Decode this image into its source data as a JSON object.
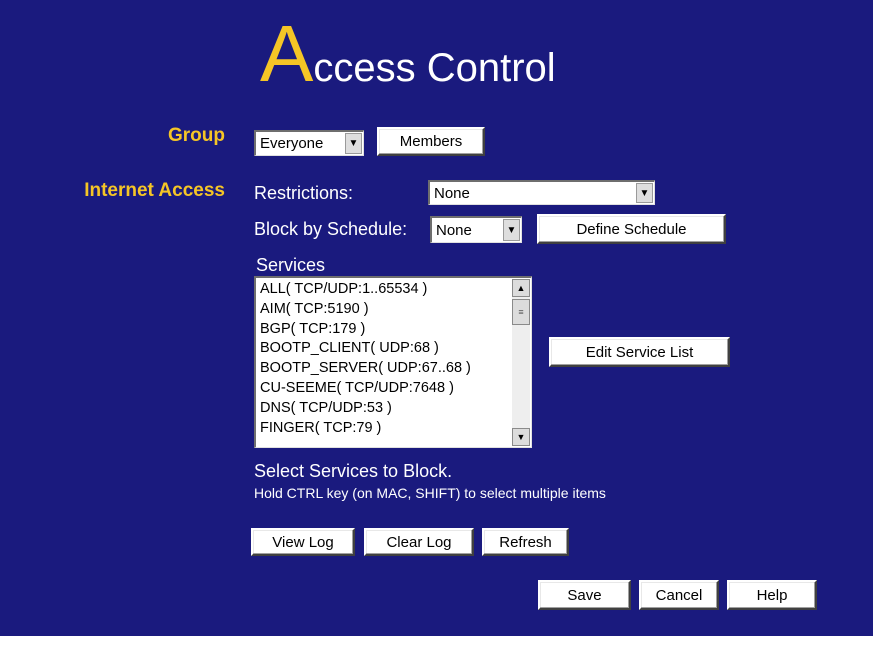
{
  "title": {
    "initial": "A",
    "rest": "ccess Control"
  },
  "group": {
    "label": "Group",
    "selected": "Everyone",
    "members_button": "Members"
  },
  "internet_access": {
    "label": "Internet Access",
    "restrictions_label": "Restrictions:",
    "restrictions_value": "None",
    "schedule_label": "Block by Schedule:",
    "schedule_value": "None",
    "define_schedule_button": "Define Schedule"
  },
  "services": {
    "label": "Services",
    "items": [
      "ALL( TCP/UDP:1..65534 )",
      "AIM( TCP:5190 )",
      "BGP( TCP:179 )",
      "BOOTP_CLIENT( UDP:68 )",
      "BOOTP_SERVER( UDP:67..68 )",
      "CU-SEEME( TCP/UDP:7648 )",
      "DNS( TCP/UDP:53 )",
      "FINGER( TCP:79 )"
    ],
    "edit_button": "Edit Service List",
    "instruction": "Select Services to Block.",
    "hint": "Hold CTRL key (on MAC, SHIFT) to select multiple items"
  },
  "log_buttons": {
    "view": "View Log",
    "clear": "Clear Log",
    "refresh": "Refresh"
  },
  "footer_buttons": {
    "save": "Save",
    "cancel": "Cancel",
    "help": "Help"
  },
  "colors": {
    "background": "#1a1a7e",
    "accent": "#f5c526",
    "text": "#ffffff"
  }
}
